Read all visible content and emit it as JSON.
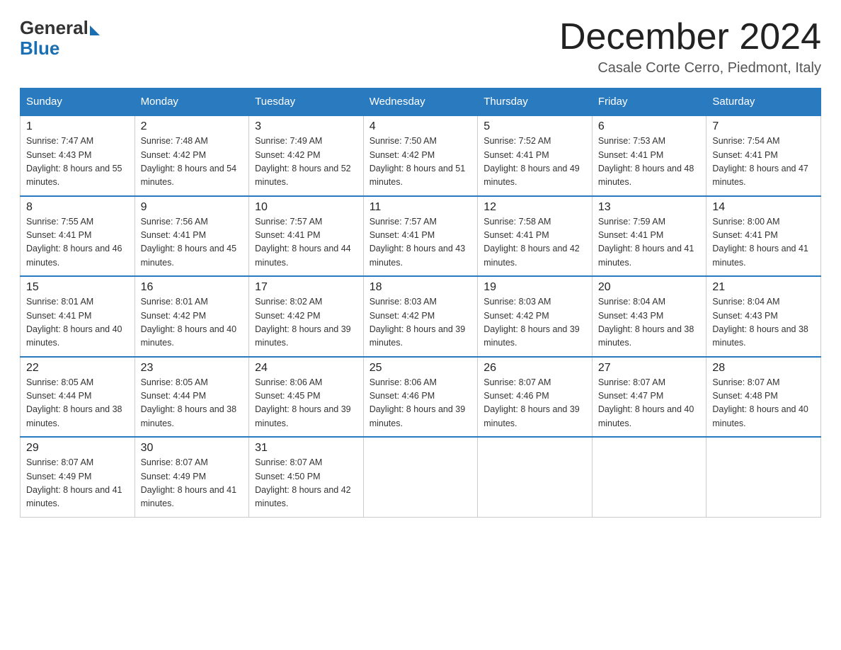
{
  "logo": {
    "general": "General",
    "blue": "Blue"
  },
  "title": "December 2024",
  "subtitle": "Casale Corte Cerro, Piedmont, Italy",
  "headers": [
    "Sunday",
    "Monday",
    "Tuesday",
    "Wednesday",
    "Thursday",
    "Friday",
    "Saturday"
  ],
  "weeks": [
    [
      {
        "day": "1",
        "sunrise": "7:47 AM",
        "sunset": "4:43 PM",
        "daylight": "8 hours and 55 minutes."
      },
      {
        "day": "2",
        "sunrise": "7:48 AM",
        "sunset": "4:42 PM",
        "daylight": "8 hours and 54 minutes."
      },
      {
        "day": "3",
        "sunrise": "7:49 AM",
        "sunset": "4:42 PM",
        "daylight": "8 hours and 52 minutes."
      },
      {
        "day": "4",
        "sunrise": "7:50 AM",
        "sunset": "4:42 PM",
        "daylight": "8 hours and 51 minutes."
      },
      {
        "day": "5",
        "sunrise": "7:52 AM",
        "sunset": "4:41 PM",
        "daylight": "8 hours and 49 minutes."
      },
      {
        "day": "6",
        "sunrise": "7:53 AM",
        "sunset": "4:41 PM",
        "daylight": "8 hours and 48 minutes."
      },
      {
        "day": "7",
        "sunrise": "7:54 AM",
        "sunset": "4:41 PM",
        "daylight": "8 hours and 47 minutes."
      }
    ],
    [
      {
        "day": "8",
        "sunrise": "7:55 AM",
        "sunset": "4:41 PM",
        "daylight": "8 hours and 46 minutes."
      },
      {
        "day": "9",
        "sunrise": "7:56 AM",
        "sunset": "4:41 PM",
        "daylight": "8 hours and 45 minutes."
      },
      {
        "day": "10",
        "sunrise": "7:57 AM",
        "sunset": "4:41 PM",
        "daylight": "8 hours and 44 minutes."
      },
      {
        "day": "11",
        "sunrise": "7:57 AM",
        "sunset": "4:41 PM",
        "daylight": "8 hours and 43 minutes."
      },
      {
        "day": "12",
        "sunrise": "7:58 AM",
        "sunset": "4:41 PM",
        "daylight": "8 hours and 42 minutes."
      },
      {
        "day": "13",
        "sunrise": "7:59 AM",
        "sunset": "4:41 PM",
        "daylight": "8 hours and 41 minutes."
      },
      {
        "day": "14",
        "sunrise": "8:00 AM",
        "sunset": "4:41 PM",
        "daylight": "8 hours and 41 minutes."
      }
    ],
    [
      {
        "day": "15",
        "sunrise": "8:01 AM",
        "sunset": "4:41 PM",
        "daylight": "8 hours and 40 minutes."
      },
      {
        "day": "16",
        "sunrise": "8:01 AM",
        "sunset": "4:42 PM",
        "daylight": "8 hours and 40 minutes."
      },
      {
        "day": "17",
        "sunrise": "8:02 AM",
        "sunset": "4:42 PM",
        "daylight": "8 hours and 39 minutes."
      },
      {
        "day": "18",
        "sunrise": "8:03 AM",
        "sunset": "4:42 PM",
        "daylight": "8 hours and 39 minutes."
      },
      {
        "day": "19",
        "sunrise": "8:03 AM",
        "sunset": "4:42 PM",
        "daylight": "8 hours and 39 minutes."
      },
      {
        "day": "20",
        "sunrise": "8:04 AM",
        "sunset": "4:43 PM",
        "daylight": "8 hours and 38 minutes."
      },
      {
        "day": "21",
        "sunrise": "8:04 AM",
        "sunset": "4:43 PM",
        "daylight": "8 hours and 38 minutes."
      }
    ],
    [
      {
        "day": "22",
        "sunrise": "8:05 AM",
        "sunset": "4:44 PM",
        "daylight": "8 hours and 38 minutes."
      },
      {
        "day": "23",
        "sunrise": "8:05 AM",
        "sunset": "4:44 PM",
        "daylight": "8 hours and 38 minutes."
      },
      {
        "day": "24",
        "sunrise": "8:06 AM",
        "sunset": "4:45 PM",
        "daylight": "8 hours and 39 minutes."
      },
      {
        "day": "25",
        "sunrise": "8:06 AM",
        "sunset": "4:46 PM",
        "daylight": "8 hours and 39 minutes."
      },
      {
        "day": "26",
        "sunrise": "8:07 AM",
        "sunset": "4:46 PM",
        "daylight": "8 hours and 39 minutes."
      },
      {
        "day": "27",
        "sunrise": "8:07 AM",
        "sunset": "4:47 PM",
        "daylight": "8 hours and 40 minutes."
      },
      {
        "day": "28",
        "sunrise": "8:07 AM",
        "sunset": "4:48 PM",
        "daylight": "8 hours and 40 minutes."
      }
    ],
    [
      {
        "day": "29",
        "sunrise": "8:07 AM",
        "sunset": "4:49 PM",
        "daylight": "8 hours and 41 minutes."
      },
      {
        "day": "30",
        "sunrise": "8:07 AM",
        "sunset": "4:49 PM",
        "daylight": "8 hours and 41 minutes."
      },
      {
        "day": "31",
        "sunrise": "8:07 AM",
        "sunset": "4:50 PM",
        "daylight": "8 hours and 42 minutes."
      },
      null,
      null,
      null,
      null
    ]
  ]
}
